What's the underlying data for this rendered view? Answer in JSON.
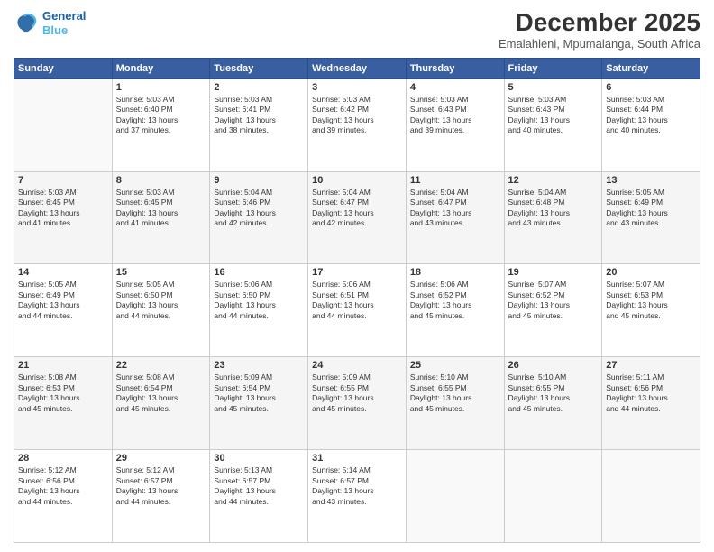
{
  "header": {
    "logo_line1": "General",
    "logo_line2": "Blue",
    "title": "December 2025",
    "subtitle": "Emalahleni, Mpumalanga, South Africa"
  },
  "days_of_week": [
    "Sunday",
    "Monday",
    "Tuesday",
    "Wednesday",
    "Thursday",
    "Friday",
    "Saturday"
  ],
  "weeks": [
    [
      {
        "day": "",
        "info": ""
      },
      {
        "day": "1",
        "info": "Sunrise: 5:03 AM\nSunset: 6:40 PM\nDaylight: 13 hours\nand 37 minutes."
      },
      {
        "day": "2",
        "info": "Sunrise: 5:03 AM\nSunset: 6:41 PM\nDaylight: 13 hours\nand 38 minutes."
      },
      {
        "day": "3",
        "info": "Sunrise: 5:03 AM\nSunset: 6:42 PM\nDaylight: 13 hours\nand 39 minutes."
      },
      {
        "day": "4",
        "info": "Sunrise: 5:03 AM\nSunset: 6:43 PM\nDaylight: 13 hours\nand 39 minutes."
      },
      {
        "day": "5",
        "info": "Sunrise: 5:03 AM\nSunset: 6:43 PM\nDaylight: 13 hours\nand 40 minutes."
      },
      {
        "day": "6",
        "info": "Sunrise: 5:03 AM\nSunset: 6:44 PM\nDaylight: 13 hours\nand 40 minutes."
      }
    ],
    [
      {
        "day": "7",
        "info": "Sunrise: 5:03 AM\nSunset: 6:45 PM\nDaylight: 13 hours\nand 41 minutes."
      },
      {
        "day": "8",
        "info": "Sunrise: 5:03 AM\nSunset: 6:45 PM\nDaylight: 13 hours\nand 41 minutes."
      },
      {
        "day": "9",
        "info": "Sunrise: 5:04 AM\nSunset: 6:46 PM\nDaylight: 13 hours\nand 42 minutes."
      },
      {
        "day": "10",
        "info": "Sunrise: 5:04 AM\nSunset: 6:47 PM\nDaylight: 13 hours\nand 42 minutes."
      },
      {
        "day": "11",
        "info": "Sunrise: 5:04 AM\nSunset: 6:47 PM\nDaylight: 13 hours\nand 43 minutes."
      },
      {
        "day": "12",
        "info": "Sunrise: 5:04 AM\nSunset: 6:48 PM\nDaylight: 13 hours\nand 43 minutes."
      },
      {
        "day": "13",
        "info": "Sunrise: 5:05 AM\nSunset: 6:49 PM\nDaylight: 13 hours\nand 43 minutes."
      }
    ],
    [
      {
        "day": "14",
        "info": "Sunrise: 5:05 AM\nSunset: 6:49 PM\nDaylight: 13 hours\nand 44 minutes."
      },
      {
        "day": "15",
        "info": "Sunrise: 5:05 AM\nSunset: 6:50 PM\nDaylight: 13 hours\nand 44 minutes."
      },
      {
        "day": "16",
        "info": "Sunrise: 5:06 AM\nSunset: 6:50 PM\nDaylight: 13 hours\nand 44 minutes."
      },
      {
        "day": "17",
        "info": "Sunrise: 5:06 AM\nSunset: 6:51 PM\nDaylight: 13 hours\nand 44 minutes."
      },
      {
        "day": "18",
        "info": "Sunrise: 5:06 AM\nSunset: 6:52 PM\nDaylight: 13 hours\nand 45 minutes."
      },
      {
        "day": "19",
        "info": "Sunrise: 5:07 AM\nSunset: 6:52 PM\nDaylight: 13 hours\nand 45 minutes."
      },
      {
        "day": "20",
        "info": "Sunrise: 5:07 AM\nSunset: 6:53 PM\nDaylight: 13 hours\nand 45 minutes."
      }
    ],
    [
      {
        "day": "21",
        "info": "Sunrise: 5:08 AM\nSunset: 6:53 PM\nDaylight: 13 hours\nand 45 minutes."
      },
      {
        "day": "22",
        "info": "Sunrise: 5:08 AM\nSunset: 6:54 PM\nDaylight: 13 hours\nand 45 minutes."
      },
      {
        "day": "23",
        "info": "Sunrise: 5:09 AM\nSunset: 6:54 PM\nDaylight: 13 hours\nand 45 minutes."
      },
      {
        "day": "24",
        "info": "Sunrise: 5:09 AM\nSunset: 6:55 PM\nDaylight: 13 hours\nand 45 minutes."
      },
      {
        "day": "25",
        "info": "Sunrise: 5:10 AM\nSunset: 6:55 PM\nDaylight: 13 hours\nand 45 minutes."
      },
      {
        "day": "26",
        "info": "Sunrise: 5:10 AM\nSunset: 6:55 PM\nDaylight: 13 hours\nand 45 minutes."
      },
      {
        "day": "27",
        "info": "Sunrise: 5:11 AM\nSunset: 6:56 PM\nDaylight: 13 hours\nand 44 minutes."
      }
    ],
    [
      {
        "day": "28",
        "info": "Sunrise: 5:12 AM\nSunset: 6:56 PM\nDaylight: 13 hours\nand 44 minutes."
      },
      {
        "day": "29",
        "info": "Sunrise: 5:12 AM\nSunset: 6:57 PM\nDaylight: 13 hours\nand 44 minutes."
      },
      {
        "day": "30",
        "info": "Sunrise: 5:13 AM\nSunset: 6:57 PM\nDaylight: 13 hours\nand 44 minutes."
      },
      {
        "day": "31",
        "info": "Sunrise: 5:14 AM\nSunset: 6:57 PM\nDaylight: 13 hours\nand 43 minutes."
      },
      {
        "day": "",
        "info": ""
      },
      {
        "day": "",
        "info": ""
      },
      {
        "day": "",
        "info": ""
      }
    ]
  ]
}
